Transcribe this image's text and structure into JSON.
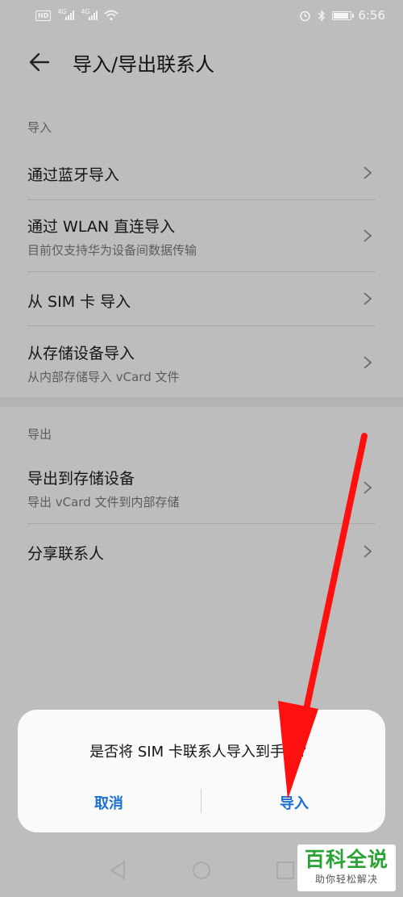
{
  "status_bar": {
    "hd_badge": "HD",
    "signal1_tag": "4G",
    "signal2_tag": "4G",
    "time": "6:56",
    "icons": [
      "hd-icon",
      "signal-icon",
      "signal-icon",
      "wifi-icon",
      "alarm-icon",
      "bluetooth-icon",
      "battery-icon"
    ]
  },
  "header": {
    "title": "导入/导出联系人",
    "back_icon": "back-arrow-icon"
  },
  "import_section": {
    "header": "导入",
    "items": [
      {
        "title": "通过蓝牙导入",
        "subtitle": ""
      },
      {
        "title": "通过 WLAN 直连导入",
        "subtitle": "目前仅支持华为设备间数据传输"
      },
      {
        "title": "从 SIM 卡 导入",
        "subtitle": ""
      },
      {
        "title": "从存储设备导入",
        "subtitle": "从内部存储导入 vCard 文件"
      }
    ]
  },
  "export_section": {
    "header": "导出",
    "items": [
      {
        "title": "导出到存储设备",
        "subtitle": "导出 vCard 文件到内部存储"
      },
      {
        "title": "分享联系人",
        "subtitle": ""
      }
    ]
  },
  "dialog": {
    "message": "是否将 SIM 卡联系人导入到手机？",
    "cancel_label": "取消",
    "confirm_label": "导入",
    "accent_color": "#1a6fd1"
  },
  "watermark": {
    "main": "百科全说",
    "sub": "助你轻松解决",
    "color": "#2aa336"
  },
  "annotation_arrow_color": "#ff1010"
}
